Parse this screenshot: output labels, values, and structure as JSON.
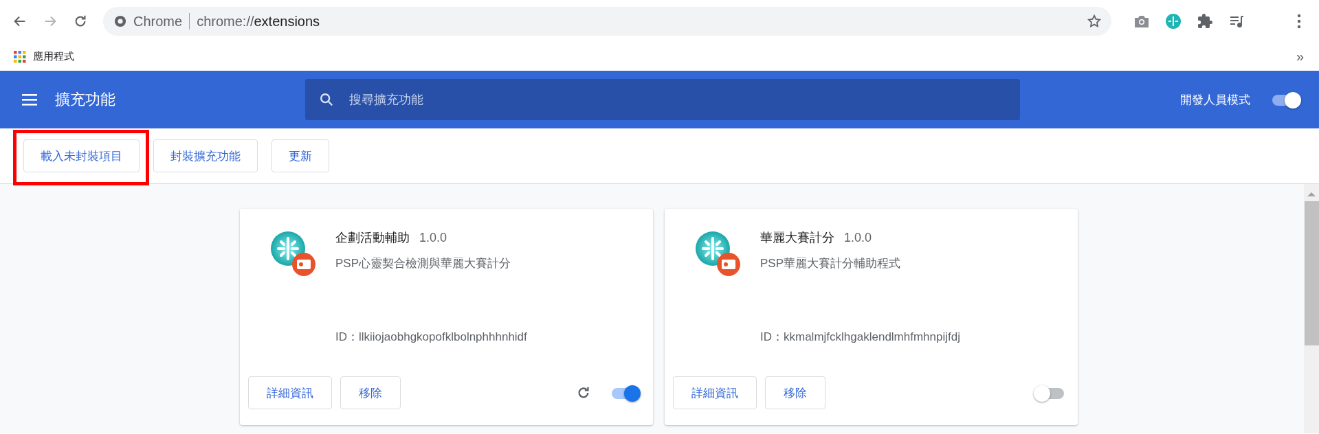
{
  "browser": {
    "back_disabled": false,
    "forward_disabled": true,
    "site_label": "Chrome",
    "url_prefix": "chrome://",
    "url_path": "extensions"
  },
  "bookmarks": {
    "items": [
      {
        "label": "應用程式"
      }
    ],
    "overflow": "»"
  },
  "header": {
    "title": "擴充功能",
    "search": {
      "placeholder": "搜尋擴充功能"
    },
    "dev_mode": {
      "label": "開發人員模式",
      "on": true
    }
  },
  "toolbar": {
    "buttons": [
      {
        "label": "載入未封裝項目",
        "highlighted": true
      },
      {
        "label": "封裝擴充功能",
        "highlighted": false
      },
      {
        "label": "更新",
        "highlighted": false
      }
    ]
  },
  "extensions": [
    {
      "name": "企劃活動輔助",
      "version": "1.0.0",
      "description": "PSP心靈契合檢測與華麗大賽計分",
      "id": "ID：llkiiojaobhgkopofklbolnphhhnhidf",
      "buttons": [
        "詳細資訊",
        "移除"
      ],
      "reload": true,
      "on": true
    },
    {
      "name": "華麗大賽計分",
      "version": "1.0.0",
      "description": "PSP華麗大賽計分輔助程式",
      "id": "ID：kkmalmjfcklhgaklendlmhfmhnpijfdj",
      "buttons": [
        "詳細資訊",
        "移除"
      ],
      "reload": false,
      "on": false
    }
  ]
}
